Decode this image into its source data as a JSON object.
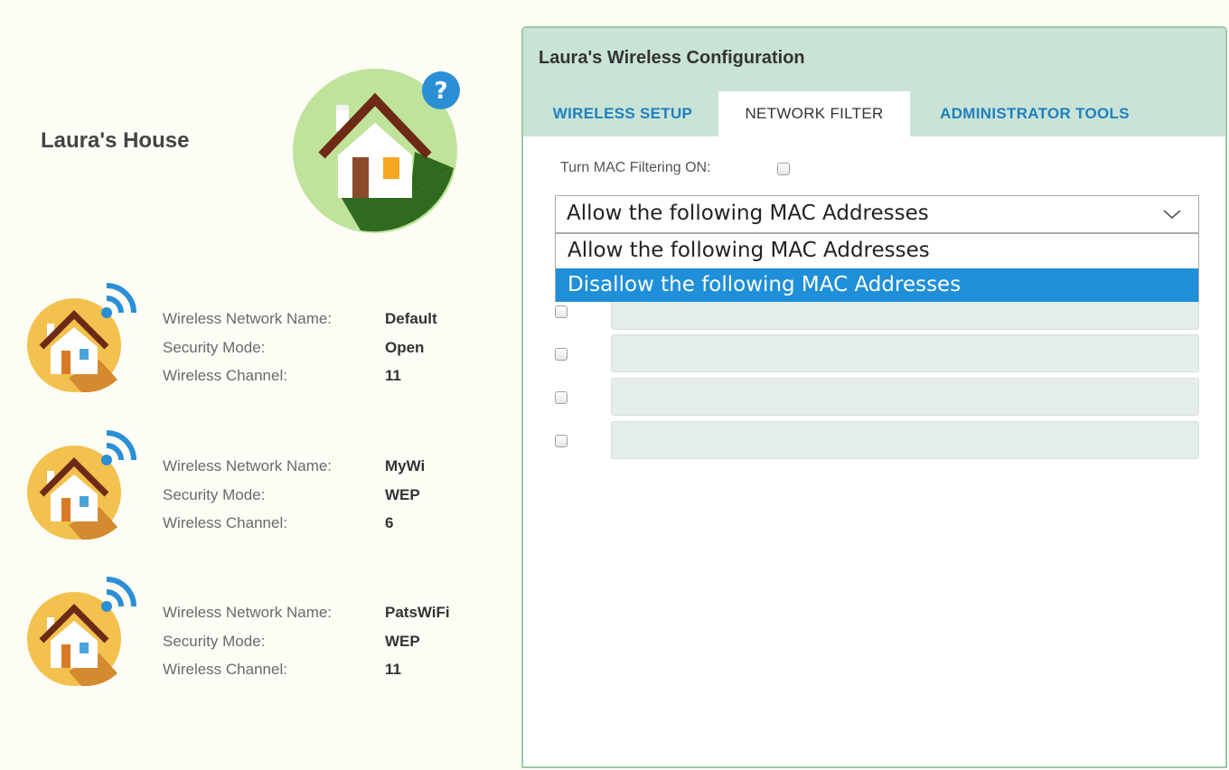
{
  "house": {
    "title": "Laura's House"
  },
  "networks": [
    {
      "name_label": "Wireless Network Name:",
      "name_value": "Default",
      "security_label": "Security Mode:",
      "security_value": "Open",
      "channel_label": "Wireless Channel:",
      "channel_value": "11"
    },
    {
      "name_label": "Wireless Network Name:",
      "name_value": "MyWi",
      "security_label": "Security Mode:",
      "security_value": "WEP",
      "channel_label": "Wireless Channel:",
      "channel_value": "6"
    },
    {
      "name_label": "Wireless Network Name:",
      "name_value": "PatsWiFi",
      "security_label": "Security Mode:",
      "security_value": "WEP",
      "channel_label": "Wireless Channel:",
      "channel_value": "11"
    }
  ],
  "panel": {
    "title": "Laura's Wireless Configuration",
    "tabs": [
      "WIRELESS SETUP",
      "NETWORK FILTER",
      "ADMINISTRATOR TOOLS"
    ],
    "active_tab": "NETWORK FILTER",
    "mac_filter_label": "Turn MAC Filtering ON:",
    "mac_filter_checked": false,
    "select": {
      "value": "Allow the following MAC Addresses",
      "options": [
        "Allow the following MAC Addresses",
        "Disallow the following MAC Addresses"
      ],
      "highlighted": "Disallow the following MAC Addresses",
      "open": true
    },
    "mac_entries": [
      {
        "checked": false,
        "value": ""
      },
      {
        "checked": false,
        "value": ""
      },
      {
        "checked": false,
        "value": ""
      },
      {
        "checked": false,
        "value": ""
      }
    ]
  },
  "icons": {
    "help": "question-mark-icon",
    "main_house": "house-icon",
    "network_house": "wireless-house-icon",
    "dropdown_arrow": "chevron-down-icon"
  },
  "colors": {
    "page_background": "#fdfcf5",
    "panel_header": "#c9e4d6",
    "tab_link": "#1f7fbf",
    "highlight": "#1e8fd8",
    "mac_field": "#e4ecec",
    "main_house_circle": "#bfe39a",
    "network_house_circle": "#f3c14d",
    "wifi_blue": "#2b8fd6"
  }
}
